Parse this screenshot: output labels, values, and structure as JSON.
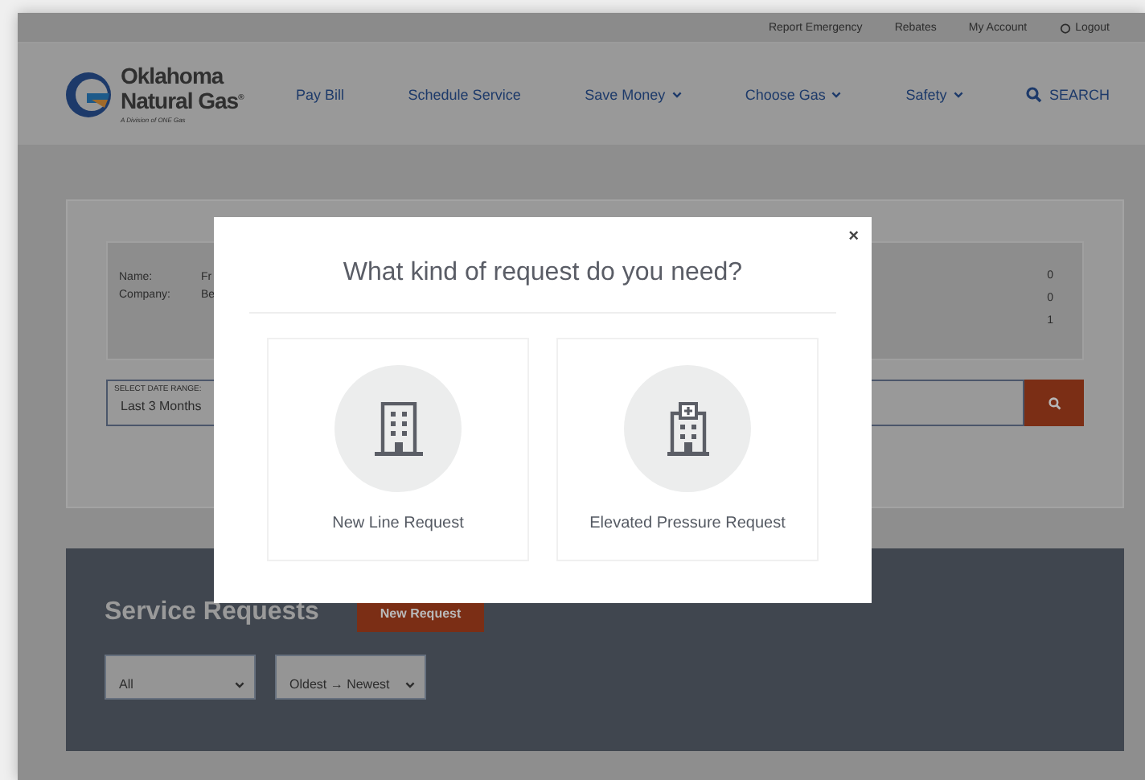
{
  "utility_bar": {
    "links": [
      "Report Emergency",
      "Rebates",
      "My Account",
      "Logout"
    ]
  },
  "header": {
    "logo": {
      "line1": "Oklahoma",
      "line2": "Natural Gas$^{®}$",
      "tagline": "A Division of ONE Gas"
    },
    "nav": [
      {
        "label": "Pay Bill",
        "dropdown": false
      },
      {
        "label": "Schedule Service",
        "dropdown": false
      },
      {
        "label": "Save Money",
        "dropdown": true
      },
      {
        "label": "Choose Gas",
        "dropdown": true
      },
      {
        "label": "Safety",
        "dropdown": true
      }
    ],
    "search": "SEARCH"
  },
  "account": {
    "fields": [
      {
        "label": "Name:",
        "value": "Fr"
      },
      {
        "label": "Company:",
        "value": "Be"
      }
    ],
    "counts": [
      "0",
      "0",
      "1"
    ]
  },
  "date_range": {
    "label": "SELECT DATE RANGE:",
    "value": "Last 3 Months"
  },
  "service_requests": {
    "title": "Service Requests",
    "new_button": "New Request",
    "filters": [
      "All",
      "Oldest → Newest"
    ]
  },
  "modal": {
    "title": "What kind of request do you need?",
    "close": "×",
    "options": [
      {
        "label": "New Line Request",
        "kind": "building"
      },
      {
        "label": "Elevated Pressure Request",
        "kind": "hospital"
      }
    ]
  }
}
